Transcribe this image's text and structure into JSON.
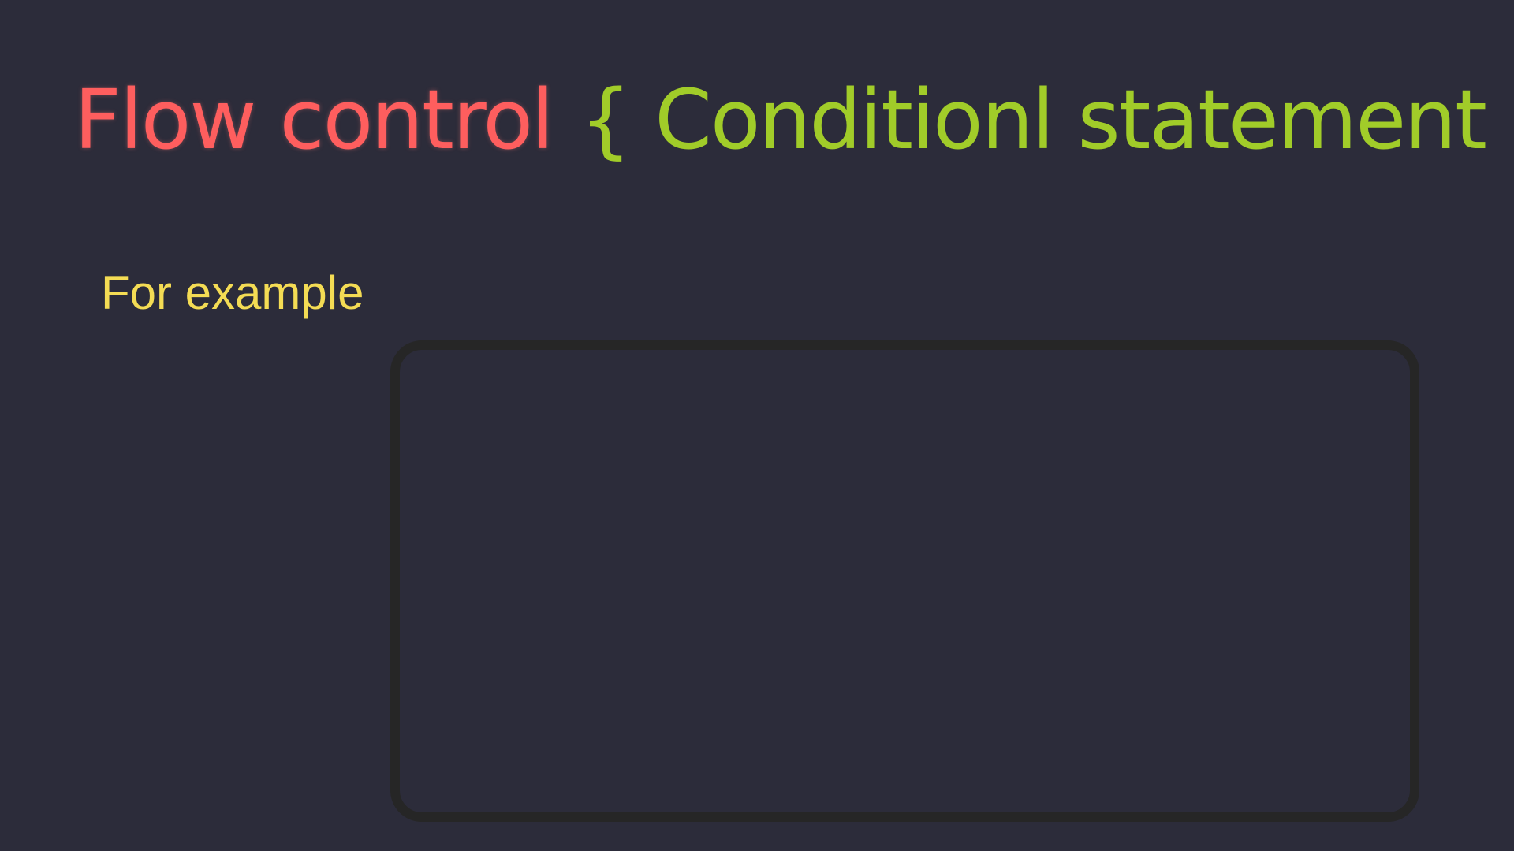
{
  "slide": {
    "title": "Flow control",
    "subtitle": "{ Conditionl statement }",
    "subheading": "For example",
    "example_box_content": ""
  },
  "colors": {
    "background": "#2c2c3a",
    "title": "#fe5e5e",
    "subtitle": "#a1cc29",
    "subheading": "#f4dc54",
    "box_border": "#262626"
  }
}
